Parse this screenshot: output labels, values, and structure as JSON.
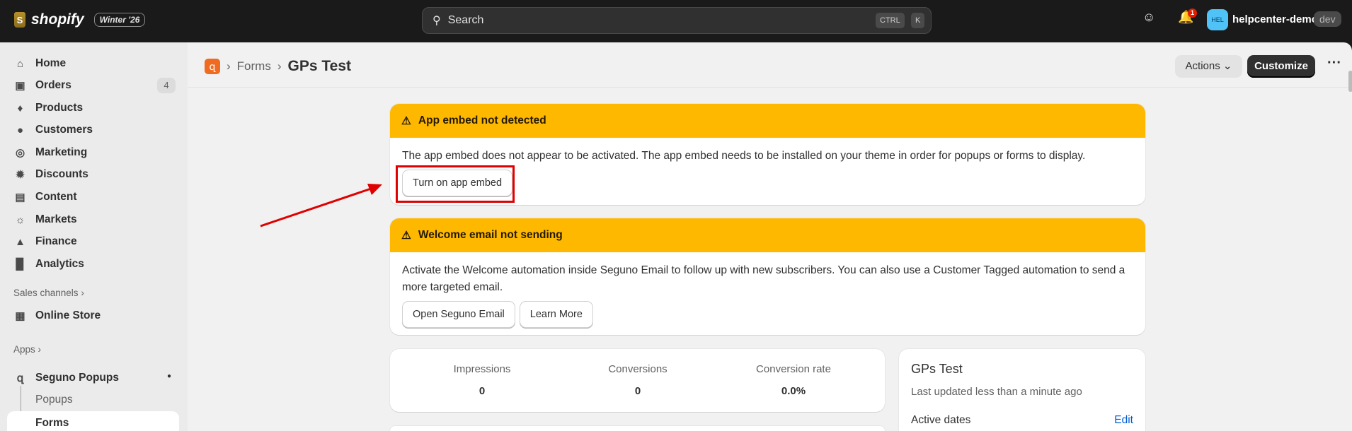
{
  "topbar": {
    "brand": "shopify",
    "version": "Winter '26",
    "search_placeholder": "Search",
    "kbd1": "CTRL",
    "kbd2": "K",
    "notif_count": "1",
    "avatar": "HEL",
    "store": "helpcenter-demo",
    "env": "dev"
  },
  "sidebar": {
    "items": [
      {
        "label": "Home",
        "icon": "home-icon"
      },
      {
        "label": "Orders",
        "icon": "inbox-icon",
        "badge": "4"
      },
      {
        "label": "Products",
        "icon": "tag-icon"
      },
      {
        "label": "Customers",
        "icon": "person-icon"
      },
      {
        "label": "Marketing",
        "icon": "target-icon"
      },
      {
        "label": "Discounts",
        "icon": "discount-icon"
      },
      {
        "label": "Content",
        "icon": "image-icon"
      },
      {
        "label": "Markets",
        "icon": "globe-icon"
      },
      {
        "label": "Finance",
        "icon": "bank-icon"
      },
      {
        "label": "Analytics",
        "icon": "bar-chart-icon"
      }
    ],
    "sales_channels": "Sales channels",
    "online_store": "Online Store",
    "apps": "Apps",
    "app_name": "Seguno Popups",
    "app_sub": [
      "Popups",
      "Forms"
    ]
  },
  "header": {
    "crumb": "Forms",
    "title": "GPs Test",
    "actions": "Actions",
    "customize": "Customize"
  },
  "alerts": [
    {
      "title": "App embed not detected",
      "body": "The app embed does not appear to be activated. The app embed needs to be installed on your theme in order for popups or forms to display.",
      "buttons": [
        "Turn on app embed"
      ]
    },
    {
      "title": "Welcome email not sending",
      "body": "Activate the Welcome automation inside Seguno Email to follow up with new subscribers. You can also use a Customer Tagged automation to send a more targeted email.",
      "buttons": [
        "Open Seguno Email",
        "Learn More"
      ]
    }
  ],
  "stats": [
    {
      "label": "Impressions",
      "value": "0"
    },
    {
      "label": "Conversions",
      "value": "0"
    },
    {
      "label": "Conversion rate",
      "value": "0.0%"
    }
  ],
  "summary": {
    "title": "GPs Test",
    "updated": "Last updated less than a minute ago",
    "active_dates": "Active dates",
    "edit": "Edit"
  },
  "colors": {
    "warning": "#ffb800",
    "annotation": "#e00000",
    "link": "#005bd3"
  }
}
